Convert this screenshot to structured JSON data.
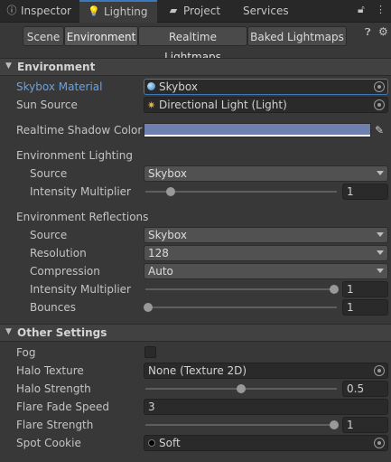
{
  "tabs": [
    {
      "label": "Inspector",
      "icon": "inspector-icon"
    },
    {
      "label": "Lighting",
      "icon": "lighting-bulb-icon",
      "active": true
    },
    {
      "label": "Project",
      "icon": "folder-icon"
    },
    {
      "label": "Services",
      "icon": ""
    }
  ],
  "toolbar": {
    "buttons": [
      "Scene",
      "Environment",
      "Realtime Lightmaps",
      "Baked Lightmaps"
    ],
    "selected": "Environment"
  },
  "environment": {
    "header": "Environment",
    "skybox_material_label": "Skybox Material",
    "skybox_material_value": "Skybox",
    "sun_source_label": "Sun Source",
    "sun_source_value": "Directional Light (Light)",
    "shadow_color_label": "Realtime Shadow Color",
    "shadow_color": "#6f7fb0",
    "lighting_group": "Environment Lighting",
    "lighting_source_label": "Source",
    "lighting_source_value": "Skybox",
    "lighting_intensity_label": "Intensity Multiplier",
    "lighting_intensity_value": "1",
    "reflections_group": "Environment Reflections",
    "refl_source_label": "Source",
    "refl_source_value": "Skybox",
    "resolution_label": "Resolution",
    "resolution_value": "128",
    "compression_label": "Compression",
    "compression_value": "Auto",
    "refl_intensity_label": "Intensity Multiplier",
    "refl_intensity_value": "1",
    "bounces_label": "Bounces",
    "bounces_value": "1"
  },
  "other": {
    "header": "Other Settings",
    "fog_label": "Fog",
    "fog_checked": false,
    "halo_texture_label": "Halo Texture",
    "halo_texture_value": "None (Texture 2D)",
    "halo_strength_label": "Halo Strength",
    "halo_strength_value": "0.5",
    "flare_fade_label": "Flare Fade Speed",
    "flare_fade_value": "3",
    "flare_strength_label": "Flare Strength",
    "flare_strength_value": "1",
    "spot_cookie_label": "Spot Cookie",
    "spot_cookie_value": "Soft"
  },
  "colors": {
    "accent": "#3a79bb",
    "panel": "#383838",
    "header": "#414141",
    "highlight_label": "#6aa2e0"
  }
}
